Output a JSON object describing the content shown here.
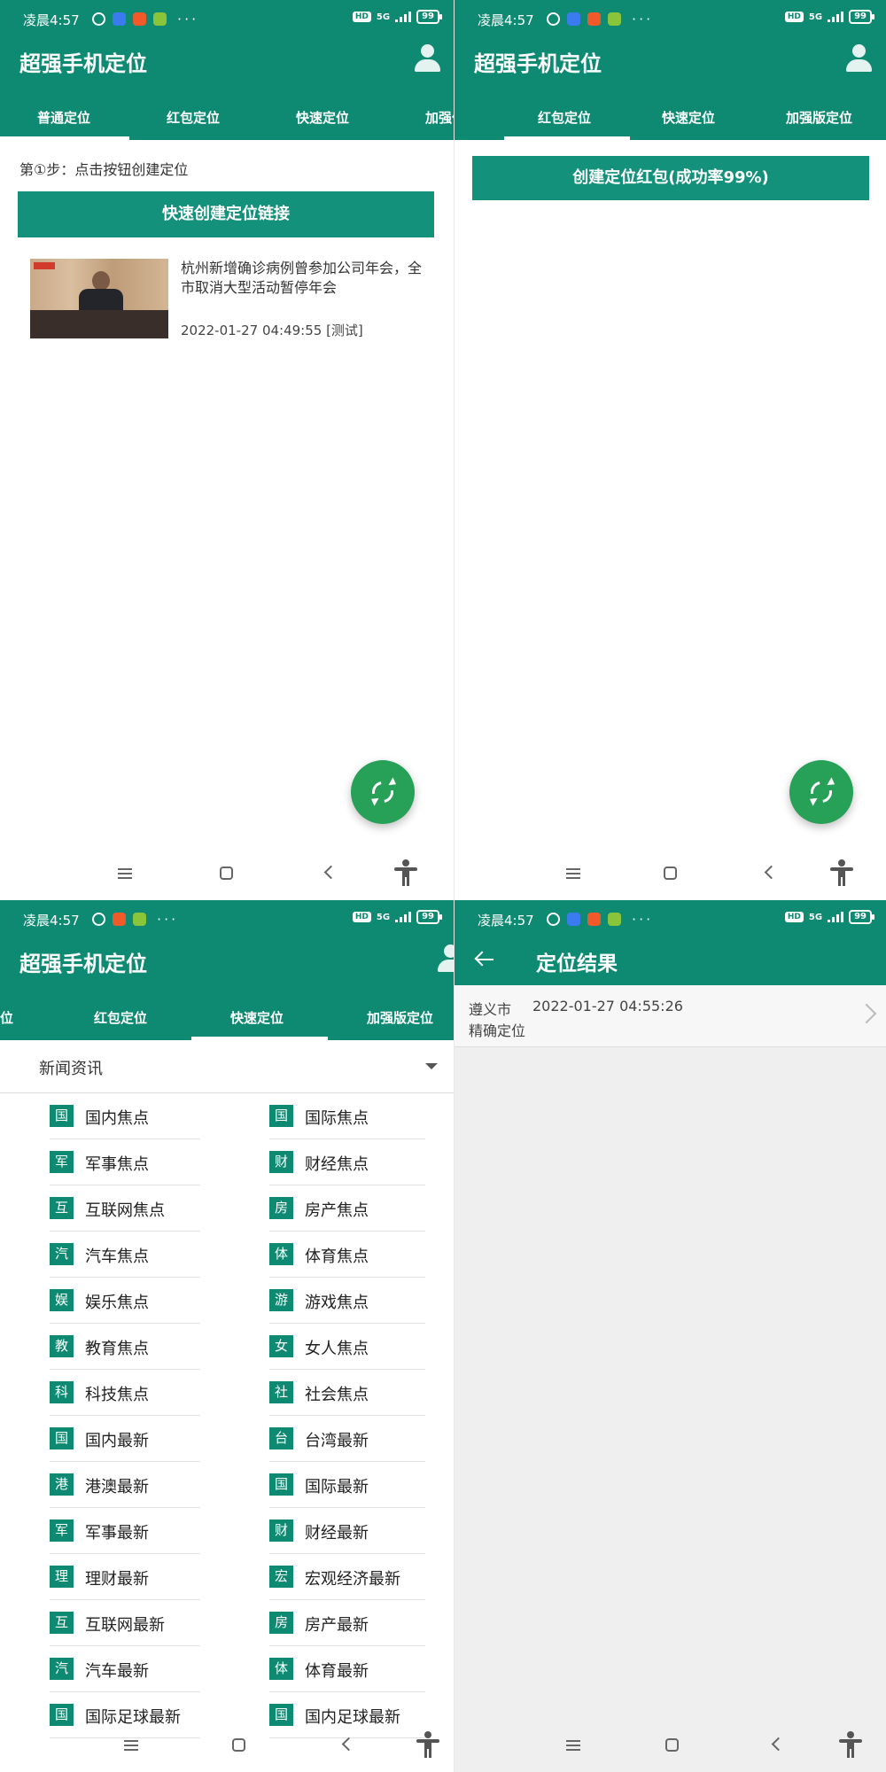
{
  "status_bar": {
    "time": "凌晨4:57",
    "hd": "HD",
    "network": "5G",
    "battery": "99"
  },
  "app": {
    "title": "超强手机定位"
  },
  "panel1": {
    "tabs": [
      "普通定位",
      "红包定位",
      "快速定位",
      "加强位"
    ],
    "hint": "第①步：点击按钮创建定位",
    "create_button": "快速创建定位链接",
    "news": {
      "title": "杭州新增确诊病例曾参加公司年会，全市取消大型活动暂停年会",
      "time": "2022-01-27 04:49:55 [测试]"
    }
  },
  "panel2": {
    "tabs": [
      "红包定位",
      "快速定位",
      "加强版定位"
    ],
    "create_button": "创建定位红包(成功率99%)"
  },
  "panel3": {
    "tabs": [
      "位",
      "红包定位",
      "快速定位",
      "加强版定位"
    ],
    "section_title": "新闻资讯",
    "categories": [
      {
        "badge": "国",
        "label": "国内焦点"
      },
      {
        "badge": "国",
        "label": "国际焦点"
      },
      {
        "badge": "军",
        "label": "军事焦点"
      },
      {
        "badge": "财",
        "label": "财经焦点"
      },
      {
        "badge": "互",
        "label": "互联网焦点"
      },
      {
        "badge": "房",
        "label": "房产焦点"
      },
      {
        "badge": "汽",
        "label": "汽车焦点"
      },
      {
        "badge": "体",
        "label": "体育焦点"
      },
      {
        "badge": "娱",
        "label": "娱乐焦点"
      },
      {
        "badge": "游",
        "label": "游戏焦点"
      },
      {
        "badge": "教",
        "label": "教育焦点"
      },
      {
        "badge": "女",
        "label": "女人焦点"
      },
      {
        "badge": "科",
        "label": "科技焦点"
      },
      {
        "badge": "社",
        "label": "社会焦点"
      },
      {
        "badge": "国",
        "label": "国内最新"
      },
      {
        "badge": "台",
        "label": "台湾最新"
      },
      {
        "badge": "港",
        "label": "港澳最新"
      },
      {
        "badge": "国",
        "label": "国际最新"
      },
      {
        "badge": "军",
        "label": "军事最新"
      },
      {
        "badge": "财",
        "label": "财经最新"
      },
      {
        "badge": "理",
        "label": "理财最新"
      },
      {
        "badge": "宏",
        "label": "宏观经济最新"
      },
      {
        "badge": "互",
        "label": "互联网最新"
      },
      {
        "badge": "房",
        "label": "房产最新"
      },
      {
        "badge": "汽",
        "label": "汽车最新"
      },
      {
        "badge": "体",
        "label": "体育最新"
      },
      {
        "badge": "国",
        "label": "国际足球最新"
      },
      {
        "badge": "国",
        "label": "国内足球最新"
      }
    ]
  },
  "panel4": {
    "title": "定位结果",
    "result": {
      "city": "遵义市",
      "time": "2022-01-27 04:55:26",
      "type": "精确定位"
    }
  },
  "colors": {
    "brand": "#0e8a72",
    "button": "#14917a",
    "fab": "#27a058"
  },
  "icons": [
    "user-icon",
    "refresh-icon",
    "back-arrow-icon",
    "chevron-right-icon",
    "dropdown-arrow-icon",
    "menu-icon",
    "home-icon",
    "back-icon",
    "accessibility-icon"
  ]
}
